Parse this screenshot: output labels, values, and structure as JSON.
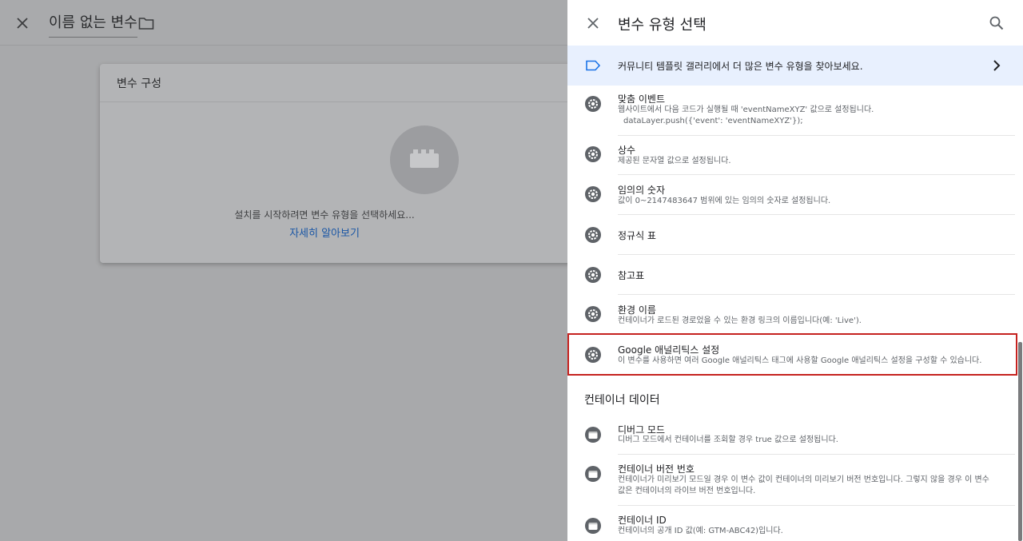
{
  "editor": {
    "title": "이름 없는 변수",
    "card_title": "변수 구성",
    "hint": "설치를 시작하려면 변수 유형을 선택하세요...",
    "learn_more": "자세히 알아보기"
  },
  "panel": {
    "title": "변수 유형 선택",
    "banner": "커뮤니티 템플릿 갤러리에서 더 많은 변수 유형을 찾아보세요.",
    "items": [
      {
        "title": "맞춤 이벤트",
        "desc": "웹사이트에서 다음 코드가 실행될 때 'eventNameXYZ' 값으로 설정됩니다.",
        "desc2": "dataLayer.push({'event': 'eventNameXYZ'});",
        "icon": "gear-icon"
      },
      {
        "title": "상수",
        "desc": "제공된 문자열 값으로 설정됩니다.",
        "icon": "gear-icon"
      },
      {
        "title": "임의의 숫자",
        "desc": "값이 0~2147483647 범위에 있는 임의의 숫자로 설정됩니다.",
        "icon": "gear-icon"
      },
      {
        "title": "정규식 표",
        "icon": "gear-icon"
      },
      {
        "title": "참고표",
        "icon": "gear-icon"
      },
      {
        "title": "환경 이름",
        "desc": "컨테이너가 로드된 경로었을 수 있는 환경 링크의 이름입니다(예: 'Live').",
        "icon": "gear-icon"
      },
      {
        "title": "Google 애널리틱스 설정",
        "desc": "이 변수를 사용하면 여러 Google 애널리틱스 태그에 사용할 Google 애널리틱스 설정을 구성할 수 있습니다.",
        "icon": "gear-icon"
      }
    ],
    "section": "컨테이너 데이터",
    "container_items": [
      {
        "title": "디버그 모드",
        "desc": "디버그 모드에서 컨테이너를 조회할 경우 true 값으로 설정됩니다.",
        "icon": "container-icon"
      },
      {
        "title": "컨테이너 버전 번호",
        "desc": "컨테이너가 미리보기 모드일 경우 이 변수 값이 컨테이너의 미리보기 버전 번호입니다. 그렇지 않을 경우 이 변수",
        "desc2": "값은 컨테이너의 라이브 버전 번호입니다.",
        "icon": "container-icon"
      },
      {
        "title": "컨테이너 ID",
        "desc": "컨테이너의 공개 ID 값(예: GTM-ABC42)입니다.",
        "icon": "container-icon"
      }
    ]
  },
  "colors": {
    "highlight": "#c5221f",
    "link": "#1a56a5",
    "banner_bg": "#e8f0fe"
  }
}
